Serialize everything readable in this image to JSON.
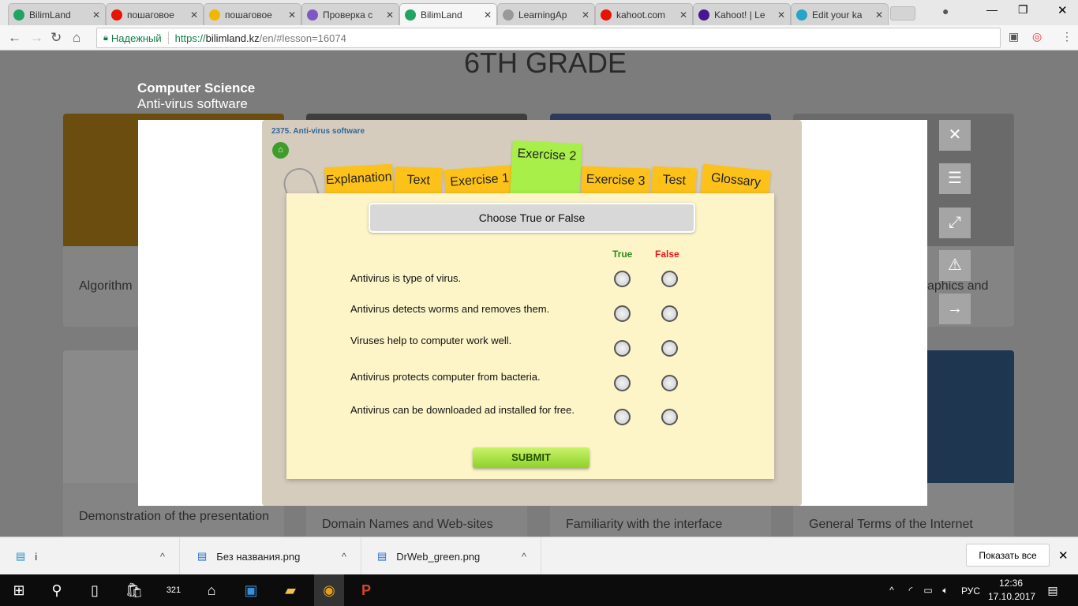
{
  "browser": {
    "tabs": [
      {
        "title": "BilimLand",
        "icon": "bilimland-icon",
        "color": "#1fa463"
      },
      {
        "title": "пошаговое",
        "icon": "yandex-icon",
        "color": "#e61400"
      },
      {
        "title": "пошаговое",
        "icon": "image-icon",
        "color": "#f3b700"
      },
      {
        "title": "Проверка с",
        "icon": "forms-icon",
        "color": "#7e57c2"
      },
      {
        "title": "BilimLand",
        "icon": "bilimland-icon",
        "color": "#1fa463",
        "active": true
      },
      {
        "title": "LearningAp",
        "icon": "learningapps-icon",
        "color": "#999999"
      },
      {
        "title": "kahoot.com",
        "icon": "yandex-icon",
        "color": "#e61400"
      },
      {
        "title": "Kahoot! | Le",
        "icon": "kahoot-icon",
        "color": "#46178f"
      },
      {
        "title": "Edit your ka",
        "icon": "kahoot-edit-icon",
        "color": "#26a5c4"
      }
    ],
    "secure_label": "Надежный",
    "url_scheme": "https://",
    "url_host": "bilimland.kz",
    "url_path": "/en/#lesson=16074"
  },
  "page": {
    "grade_heading": "6TH GRADE",
    "subject": "Computer Science",
    "topic": "Anti-virus software",
    "cards": [
      "Algorithm",
      "",
      "",
      "Graphics and",
      "Demonstration of the presentation",
      "Domain Names and Web-sites",
      "Familiarity with the interface",
      "General Terms of the Internet"
    ],
    "partial_card_texts": {
      "left": "Algorithm",
      "right": "aphics and"
    }
  },
  "lesson": {
    "title": "2375. Anti-virus software",
    "tabs": [
      "Explanation",
      "Text",
      "Exercise 1",
      "Exercise 2",
      "Exercise 3",
      "Test",
      "Glossary"
    ],
    "active_tab": "Exercise 2",
    "instruction": "Choose True or False",
    "col_true": "True",
    "col_false": "False",
    "questions": [
      "Antivirus is type of virus.",
      "Antivirus detects worms and removes them.",
      "Viruses help to computer work well.",
      "Antivirus protects computer from bacteria.",
      "Antivirus can be downloaded ad installed for free."
    ],
    "submit": "SUBMIT",
    "colors": {
      "true": "#2e8b1e",
      "false": "#e8141c",
      "tab": "#fcc21a",
      "active_tab": "#a8ef4a",
      "paper": "#fdf5c8"
    }
  },
  "downloads": {
    "items": [
      {
        "name": "i"
      },
      {
        "name": "Без названия.png"
      },
      {
        "name": "DrWeb_green.png"
      }
    ],
    "show_all": "Показать все"
  },
  "taskbar": {
    "time": "12:36",
    "date": "17.10.2017",
    "lang": "РУС"
  }
}
